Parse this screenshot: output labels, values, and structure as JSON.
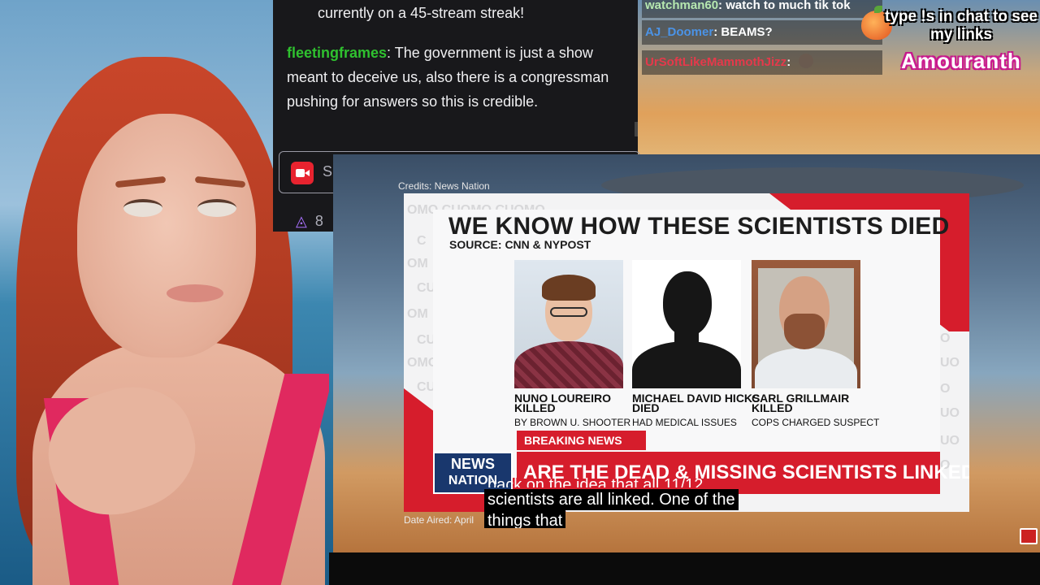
{
  "chat": {
    "partial_line": "currently on a 45-stream streak!",
    "message_user": "fleetingframes",
    "message_text": ": The government is just a show meant to deceive us, also there is a congressman pushing for answers so this is credible.",
    "input_placeholder": "S",
    "points": "8"
  },
  "overlay_chat": [
    {
      "user": "watchman60",
      "text": "watch to much tik tok"
    },
    {
      "user": "AJ_Doomer",
      "text": "BEAMS?"
    },
    {
      "user": "UrSoftLikeMammothJizz",
      "text": ""
    }
  ],
  "banner": {
    "line": "type !s in chat to see my links",
    "name": "Amouranth"
  },
  "video": {
    "credits": "Credits: News Nation",
    "date_aired": "Date Aired: April",
    "headline": "WE KNOW HOW THESE SCIENTISTS DIED",
    "source": "SOURCE: CNN & NYPOST",
    "people": [
      {
        "name": "NUNO LOUREIRO",
        "status": "KILLED",
        "detail": "BY BROWN U. SHOOTER"
      },
      {
        "name": "MICHAEL DAVID HICKS",
        "status": "DIED",
        "detail": "HAD MEDICAL ISSUES"
      },
      {
        "name": "CARL GRILLMAIR",
        "status": "KILLED",
        "detail": "COPS CHARGED SUSPECT"
      }
    ],
    "breaking": "BREAKING NEWS",
    "logo_line1": "NEWS",
    "logo_line2": "NATION",
    "ticker": "ARE THE DEAD & MISSING SCIENTISTS LINKED?",
    "subtitle_partial": "back on the idea that all 11/12",
    "subtitle_line1": "scientists are all linked. One of the",
    "subtitle_line2": "things that"
  },
  "colors": {
    "chat_bg": "#18181b",
    "username_green": "#2fc12f",
    "news_red": "#d61d2c",
    "news_navy": "#19376d",
    "bikini_pink": "#e0295f"
  }
}
